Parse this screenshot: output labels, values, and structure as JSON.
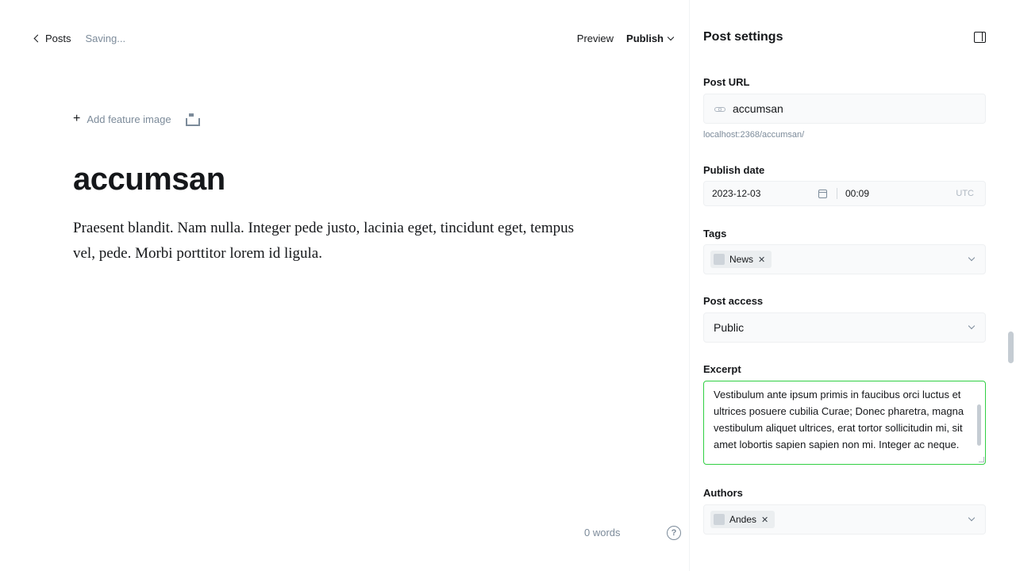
{
  "editor": {
    "back_label": "Posts",
    "save_status": "Saving...",
    "preview_label": "Preview",
    "publish_label": "Publish",
    "add_feature_label": "Add feature image",
    "title": "accumsan",
    "body": "Praesent blandit. Nam nulla. Integer pede justo, lacinia eget, tincidunt eget, tempus vel, pede. Morbi porttitor lorem id ligula.",
    "word_count": "0 words",
    "help_label": "?"
  },
  "sidebar": {
    "title": "Post settings",
    "post_url": {
      "label": "Post URL",
      "value": "accumsan",
      "hint": "localhost:2368/accumsan/"
    },
    "publish_date": {
      "label": "Publish date",
      "date": "2023-12-03",
      "time": "00:09",
      "timezone": "UTC"
    },
    "tags": {
      "label": "Tags",
      "items": [
        {
          "name": "News"
        }
      ]
    },
    "post_access": {
      "label": "Post access",
      "value": "Public"
    },
    "excerpt": {
      "label": "Excerpt",
      "value": "Vestibulum ante ipsum primis in faucibus orci luctus et ultrices posuere cubilia Curae; Donec pharetra, magna vestibulum aliquet ultrices, erat tortor sollicitudin mi, sit amet lobortis sapien sapien non mi. Integer ac neque."
    },
    "authors": {
      "label": "Authors",
      "items": [
        {
          "name": "Andes"
        }
      ]
    }
  },
  "colors": {
    "accent_green": "#30cf43",
    "text": "#15171a",
    "muted": "#7c8b9a"
  }
}
